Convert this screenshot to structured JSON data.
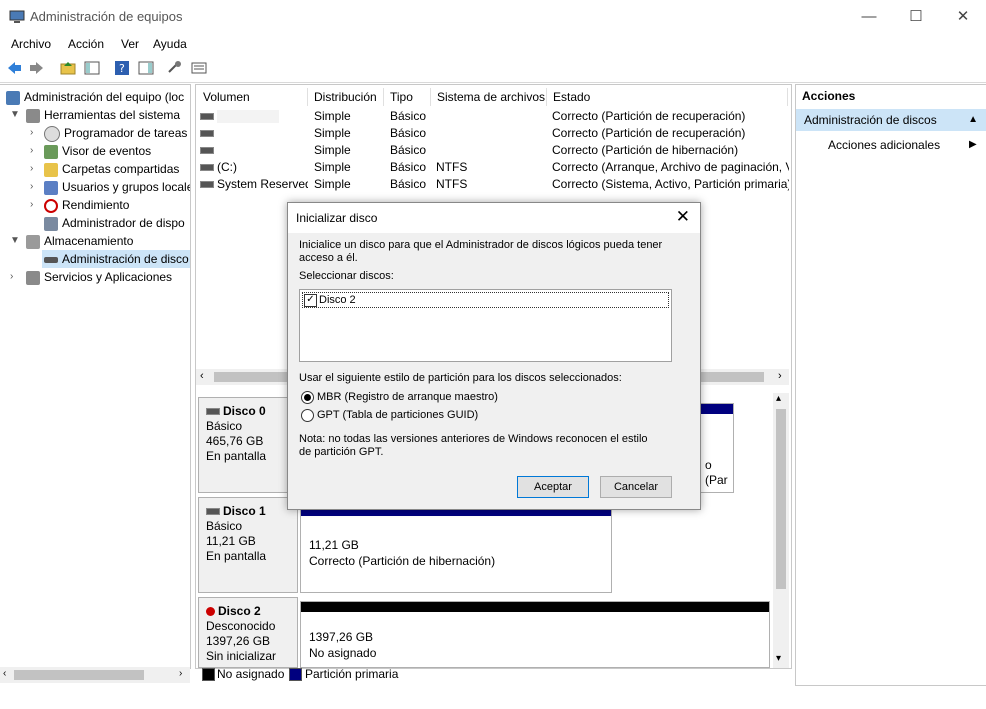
{
  "window": {
    "title": "Administración de equipos",
    "controls": [
      "—",
      "☐",
      "✕"
    ]
  },
  "menu": [
    "Archivo",
    "Acción",
    "Ver",
    "Ayuda"
  ],
  "tree": {
    "root": "Administración del equipo (loc",
    "items": [
      {
        "label": "Herramientas del sistema"
      },
      {
        "label": "Programador de tareas"
      },
      {
        "label": "Visor de eventos"
      },
      {
        "label": "Carpetas compartidas"
      },
      {
        "label": "Usuarios y grupos locale"
      },
      {
        "label": "Rendimiento"
      },
      {
        "label": "Administrador de dispo"
      },
      {
        "label": "Almacenamiento"
      },
      {
        "label": "Administración de disco"
      },
      {
        "label": "Servicios y Aplicaciones"
      }
    ]
  },
  "volumes": {
    "columns": [
      "Volumen",
      "Distribución",
      "Tipo",
      "Sistema de archivos",
      "Estado"
    ],
    "rows": [
      [
        "",
        "Simple",
        "Básico",
        "",
        "Correcto (Partición de recuperación)"
      ],
      [
        "",
        "Simple",
        "Básico",
        "",
        "Correcto (Partición de recuperación)"
      ],
      [
        "",
        "Simple",
        "Básico",
        "",
        "Correcto (Partición de hibernación)"
      ],
      [
        "(C:)",
        "Simple",
        "Básico",
        "NTFS",
        "Correcto (Arranque, Archivo de paginación, V"
      ],
      [
        "System Reserved",
        "Simple",
        "Básico",
        "NTFS",
        "Correcto (Sistema, Activo, Partición primaria)"
      ]
    ]
  },
  "disks": [
    {
      "name": "Disco 0",
      "type": "Básico",
      "size": "465,76 GB",
      "status": "En pantalla",
      "part_text": "o (Par"
    },
    {
      "name": "Disco 1",
      "type": "Básico",
      "size": "11,21 GB",
      "status": "En pantalla",
      "part_size": "11,21 GB",
      "part_state": "Correcto (Partición de hibernación)"
    },
    {
      "name": "Disco 2",
      "type": "Desconocido",
      "size": "1397,26 GB",
      "status": "Sin inicializar",
      "part_size": "1397,26 GB",
      "part_state": "No asignado"
    }
  ],
  "legend": [
    "No asignado",
    "Partición primaria"
  ],
  "actions": {
    "header": "Acciones",
    "section": "Administración de discos",
    "item": "Acciones adicionales"
  },
  "dialog": {
    "title": "Inicializar disco",
    "intro": "Inicialice un disco para que el Administrador de discos lógicos pueda tener acceso a él.",
    "select_label": "Seleccionar discos:",
    "disk_item": "Disco 2",
    "style_label": "Usar el siguiente estilo de partición para los discos seleccionados:",
    "option_mbr": "MBR (Registro de arranque maestro)",
    "option_gpt": "GPT (Tabla de particiones GUID)",
    "note": "Nota: no todas las versiones anteriores de Windows reconocen el estilo de partición GPT.",
    "ok": "Aceptar",
    "cancel": "Cancelar"
  },
  "colors": {
    "primary_partition": "#00007f",
    "unallocated": "#000000",
    "selection": "#cce4f7"
  }
}
